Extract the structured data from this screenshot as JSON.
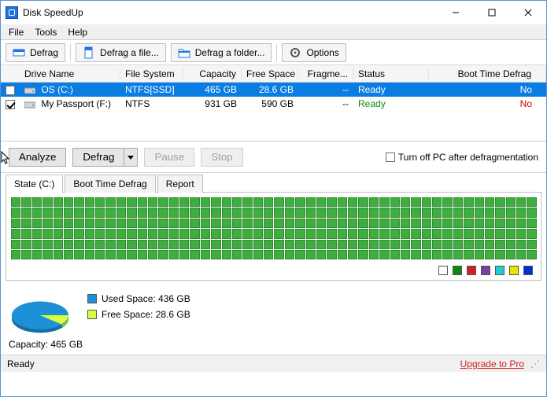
{
  "app": {
    "title": "Disk SpeedUp"
  },
  "window_controls": {
    "minimize": "—",
    "maximize": "□",
    "close": "✕"
  },
  "menubar": {
    "file": "File",
    "tools": "Tools",
    "help": "Help"
  },
  "toolbar": {
    "defrag": "Defrag",
    "defrag_file": "Defrag a file...",
    "defrag_folder": "Defrag a folder...",
    "options": "Options"
  },
  "columns": {
    "name": "Drive Name",
    "fs": "File System",
    "cap": "Capacity",
    "free": "Free Space",
    "frag": "Fragme...",
    "status": "Status",
    "btd": "Boot Time Defrag"
  },
  "rows": [
    {
      "checked": false,
      "name": "OS (C:)",
      "fs": "NTFS[SSD]",
      "cap": "465 GB",
      "free": "28.6 GB",
      "frag": "--",
      "status": "Ready",
      "btd": "No",
      "selected": true
    },
    {
      "checked": true,
      "name": "My Passport (F:)",
      "fs": "NTFS",
      "cap": "931 GB",
      "free": "590 GB",
      "frag": "--",
      "status": "Ready",
      "btd": "No",
      "selected": false
    }
  ],
  "actions": {
    "analyze": "Analyze",
    "defrag": "Defrag",
    "pause": "Pause",
    "stop": "Stop",
    "turnoff": "Turn off PC after defragmentation"
  },
  "tabs": {
    "state": "State (C:)",
    "btd": "Boot Time Defrag",
    "report": "Report"
  },
  "legend_colors": [
    "#ffffff",
    "#0a8a0a",
    "#d02020",
    "#7a3f9f",
    "#20d0d0",
    "#e6e600",
    "#0030d0"
  ],
  "pie": {
    "used_color": "#1e90d6",
    "free_color": "#d6ff40",
    "used_label": "Used Space: 436 GB",
    "free_label": "Free Space: 28.6 GB"
  },
  "capacity_label": "Capacity: 465 GB",
  "statusbar": {
    "ready": "Ready",
    "upgrade": "Upgrade to Pro"
  },
  "chart_data": {
    "type": "pie",
    "title": "",
    "series": [
      {
        "name": "Used Space",
        "value": 436,
        "unit": "GB",
        "color": "#1e90d6"
      },
      {
        "name": "Free Space",
        "value": 28.6,
        "unit": "GB",
        "color": "#d6ff40"
      }
    ],
    "total": {
      "label": "Capacity",
      "value": 465,
      "unit": "GB"
    }
  }
}
